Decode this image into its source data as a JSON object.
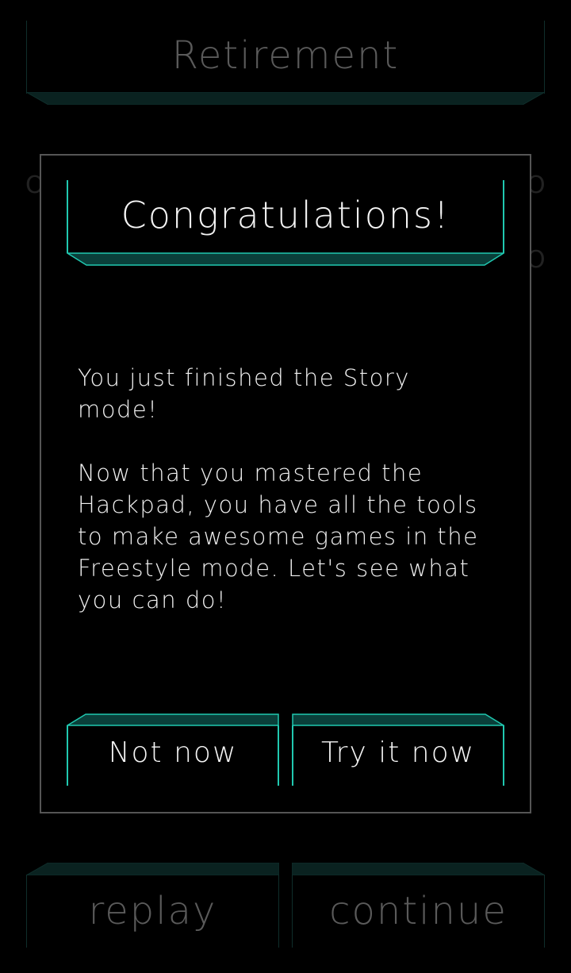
{
  "background": {
    "title": "Retirement",
    "buttons": {
      "replay": "replay",
      "continue": "continue"
    }
  },
  "dialog": {
    "title": "Congratulations!",
    "message_1": "You just finished the Story mode!",
    "message_2": "Now that you mastered the Hackpad, you have all the tools to make awesome games in the Freestyle mode. Let's see what you can do!",
    "buttons": {
      "not_now": "Not now",
      "try_it_now": "Try it now"
    }
  },
  "colors": {
    "accent": "#20c8b0",
    "accent_fill": "#0a3f3a",
    "dim_accent": "#0f2e2b",
    "background": "#000000",
    "text": "#f4f4f4"
  }
}
